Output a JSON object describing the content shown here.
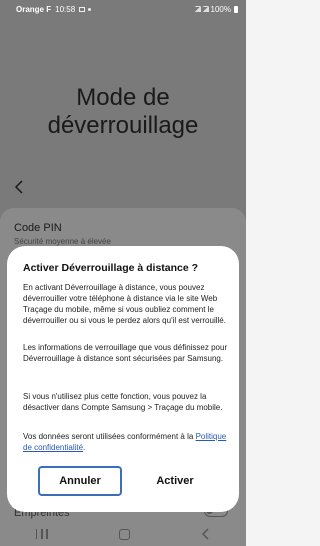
{
  "status_bar": {
    "carrier": "Orange F",
    "time": "10:58",
    "battery": "100%"
  },
  "background": {
    "title_line1": "Mode de",
    "title_line2": "déverrouillage",
    "item_title": "Code PIN",
    "item_subtitle": "Sécurité moyenne à élevée",
    "bottom_item": "Empreintes"
  },
  "dialog": {
    "title": "Activer Déverrouillage à distance ?",
    "paragraph1": "En activant Déverrouillage à distance, vous pouvez déverrouiller votre téléphone à distance via le site Web Traçage du mobile, même si vous oubliez comment le déverrouiller ou si vous le perdez alors qu'il est verrouillé.",
    "paragraph2": "Les informations de verrouillage que vous définissez pour Déverrouillage à distance sont sécurisées par Samsung.",
    "paragraph3": "Si vous n'utilisez plus cette fonction, vous pouvez la désactiver dans Compte Samsung > Traçage du mobile.",
    "paragraph4_text": "Vos données seront utilisées conformément à la",
    "paragraph4_link": "Politique de confidentialité",
    "paragraph4_end": ".",
    "cancel_label": "Annuler",
    "confirm_label": "Activer"
  },
  "colors": {
    "accent": "#3b6fb8",
    "link": "#2a5ab8",
    "scrim": "#7a7a7a"
  },
  "icons": [
    "gallery-icon",
    "dot-icon",
    "signal-icon",
    "battery-icon",
    "back-arrow-icon",
    "recents-icon",
    "home-icon",
    "nav-back-icon"
  ]
}
